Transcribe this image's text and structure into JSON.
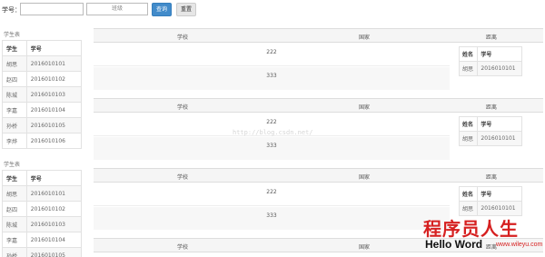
{
  "search": {
    "label": "学号：",
    "input1_value": "",
    "input2_placeholder": "班级",
    "query_label": "查询",
    "reset_label": "重置"
  },
  "lists": [
    {
      "caption": "学生表",
      "headers": [
        "学生",
        "学号"
      ],
      "rows": [
        [
          "胡思",
          "2016010101"
        ],
        [
          "赵四",
          "2016010102"
        ],
        [
          "陈城",
          "2016010103"
        ],
        [
          "李嘉",
          "2016010104"
        ],
        [
          "孙桥",
          "2016010105"
        ],
        [
          "李烨",
          "2016010106"
        ]
      ]
    },
    {
      "caption": "学生表",
      "headers": [
        "学生",
        "学号"
      ],
      "rows": [
        [
          "胡思",
          "2016010101"
        ],
        [
          "赵四",
          "2016010102"
        ],
        [
          "陈城",
          "2016010103"
        ],
        [
          "李嘉",
          "2016010104"
        ],
        [
          "孙桥",
          "2016010105"
        ]
      ]
    }
  ],
  "blocks": [
    {
      "headers": [
        "学校",
        "国家",
        "距离"
      ],
      "rows": [
        "222",
        "333"
      ],
      "mini_headers": [
        "姓名",
        "学号"
      ],
      "mini_row": [
        "胡思",
        "2016010101"
      ]
    },
    {
      "headers": [
        "学校",
        "国家",
        "距离"
      ],
      "rows": [
        "222",
        "333"
      ],
      "mini_headers": [
        "姓名",
        "学号"
      ],
      "mini_row": [
        "胡思",
        "2016010101"
      ]
    },
    {
      "headers": [
        "学校",
        "国家",
        "距离"
      ],
      "rows": [
        "222",
        "333"
      ],
      "mini_headers": [
        "姓名",
        "学号"
      ],
      "mini_row": [
        "胡思",
        "2016010101"
      ]
    },
    {
      "headers": [
        "学校",
        "国家",
        "距离"
      ]
    }
  ],
  "watermark": {
    "url": "http://blog.csdn.net/",
    "cn": "程序员人生",
    "en": "Hello Word",
    "domain": "www.wileyu.com"
  }
}
